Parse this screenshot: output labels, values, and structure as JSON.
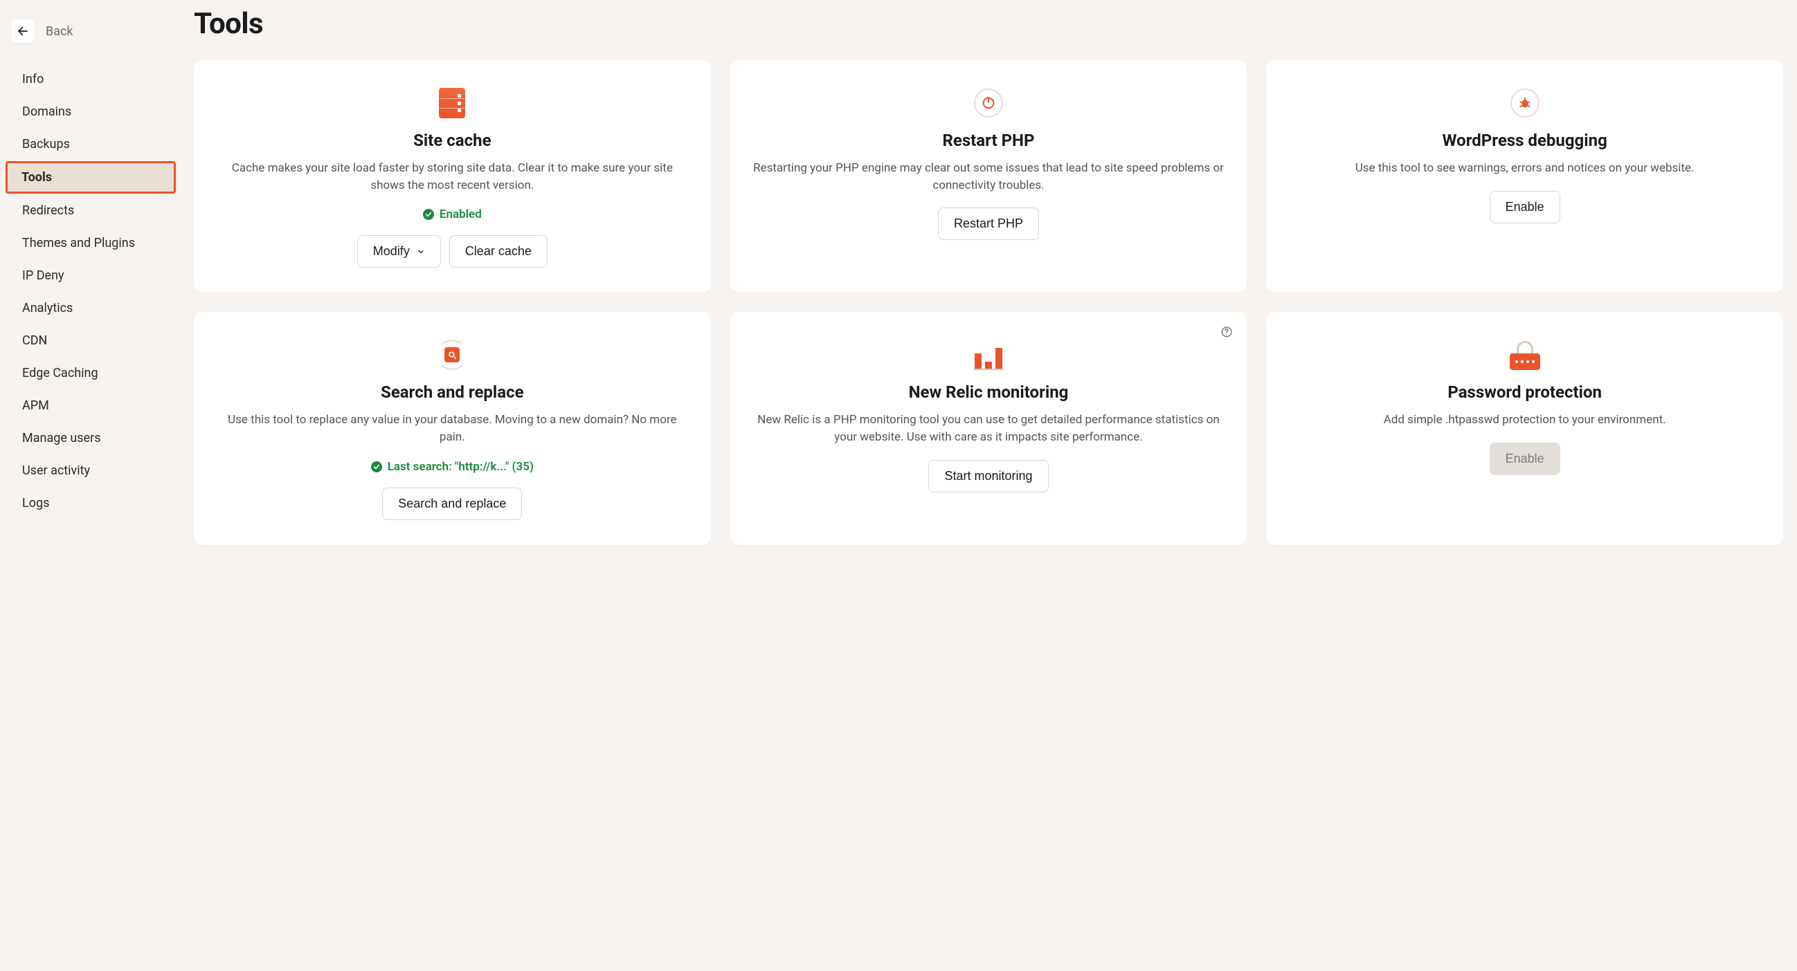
{
  "back_label": "Back",
  "page_title": "Tools",
  "sidebar": {
    "items": [
      {
        "label": "Info"
      },
      {
        "label": "Domains"
      },
      {
        "label": "Backups"
      },
      {
        "label": "Tools"
      },
      {
        "label": "Redirects"
      },
      {
        "label": "Themes and Plugins"
      },
      {
        "label": "IP Deny"
      },
      {
        "label": "Analytics"
      },
      {
        "label": "CDN"
      },
      {
        "label": "Edge Caching"
      },
      {
        "label": "APM"
      },
      {
        "label": "Manage users"
      },
      {
        "label": "User activity"
      },
      {
        "label": "Logs"
      }
    ]
  },
  "cards": {
    "site_cache": {
      "title": "Site cache",
      "desc": "Cache makes your site load faster by storing site data. Clear it to make sure your site shows the most recent version.",
      "status": "Enabled",
      "modify_label": "Modify",
      "clear_label": "Clear cache"
    },
    "restart_php": {
      "title": "Restart PHP",
      "desc": "Restarting your PHP engine may clear out some issues that lead to site speed problems or connectivity troubles.",
      "button": "Restart PHP"
    },
    "wp_debug": {
      "title": "WordPress debugging",
      "desc": "Use this tool to see warnings, errors and notices on your website.",
      "button": "Enable"
    },
    "search_replace": {
      "title": "Search and replace",
      "desc": "Use this tool to replace any value in your database. Moving to a new domain? No more pain.",
      "status": "Last search: \"http://k...\" (35)",
      "button": "Search and replace"
    },
    "new_relic": {
      "title": "New Relic monitoring",
      "desc": "New Relic is a PHP monitoring tool you can use to get detailed performance statistics on your website. Use with care as it impacts site performance.",
      "button": "Start monitoring"
    },
    "password": {
      "title": "Password protection",
      "desc": "Add simple .htpasswd protection to your environment.",
      "button": "Enable"
    }
  }
}
